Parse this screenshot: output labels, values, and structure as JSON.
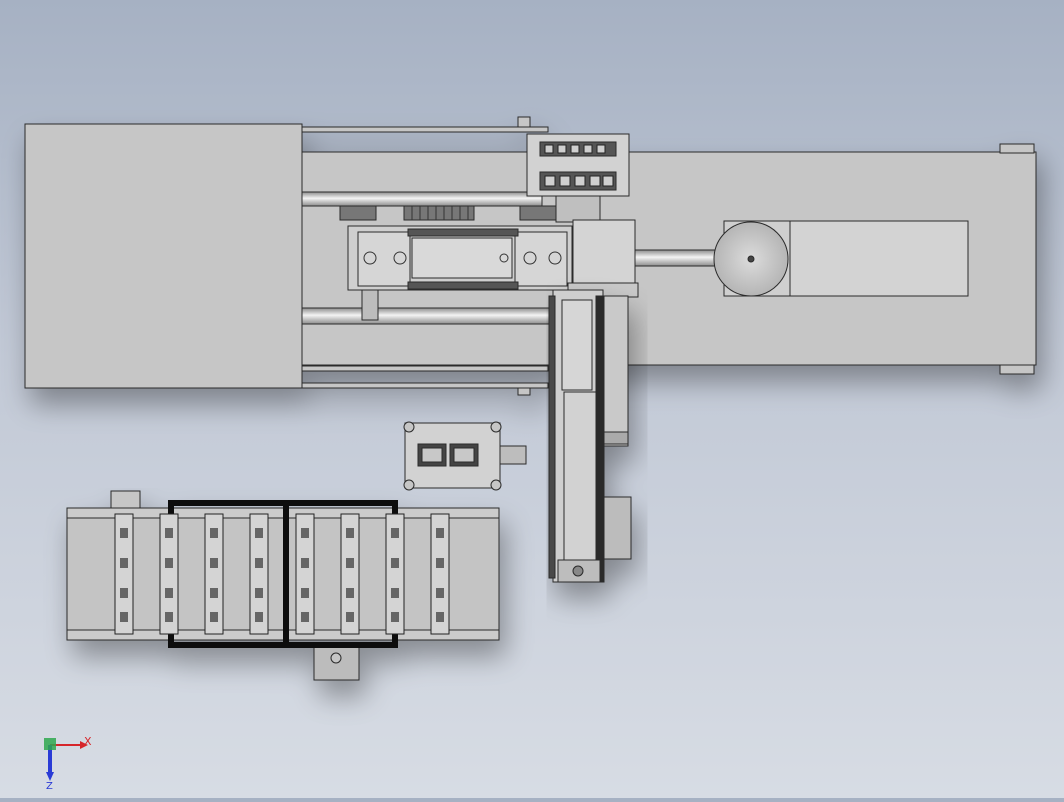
{
  "view": {
    "type": "CAD top view",
    "background_colors": [
      "#a6b1c3",
      "#d7dce4"
    ],
    "part_fill": "#c6c6c6",
    "line_color": "#2b2b2b"
  },
  "triad": {
    "x_label": "X",
    "z_label": "Z",
    "x_color": "#d6262b",
    "y_color": "#2fa84f",
    "z_color": "#2a3bd6"
  }
}
